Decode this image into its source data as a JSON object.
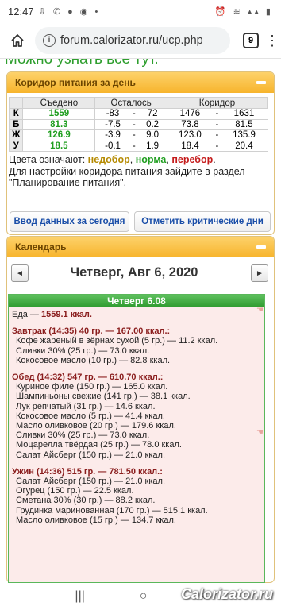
{
  "status": {
    "time": "12:47",
    "left_icons": "⇩ ✆ ● ◉ •",
    "right_icons": "⏰ ≋ ▴▴ ▮"
  },
  "browser": {
    "url": "forum.calorizator.ru/ucp.php",
    "tab_count": "9"
  },
  "page": {
    "cut_heading": "Можно узнать всё тут."
  },
  "corridor": {
    "title": "Коридор питания за день",
    "headers": [
      "",
      "Съедено",
      "Осталось",
      "Коридор"
    ],
    "rows": [
      {
        "label": "К",
        "eaten": "1559",
        "left_a": "-83",
        "left_b": "72",
        "corr_a": "1476",
        "corr_b": "1631"
      },
      {
        "label": "Б",
        "eaten": "81.3",
        "left_a": "-7.5",
        "left_b": "0.2",
        "corr_a": "73.8",
        "corr_b": "81.5"
      },
      {
        "label": "Ж",
        "eaten": "126.9",
        "left_a": "-3.9",
        "left_b": "9.0",
        "corr_a": "123.0",
        "corr_b": "135.9"
      },
      {
        "label": "У",
        "eaten": "18.5",
        "left_a": "-0.1",
        "left_b": "1.9",
        "corr_a": "18.4",
        "corr_b": "20.4"
      }
    ],
    "legend_prefix": "Цвета означают: ",
    "legend_under": "недобор",
    "legend_sep1": ", ",
    "legend_norm": "норма",
    "legend_sep2": ", ",
    "legend_over": "перебор",
    "legend_end": ".",
    "hint": "Для настройки коридора питания зайдите в раздел \"Планирование питания\".",
    "btn_input": "Ввод данных за сегодня",
    "btn_critical": "Отметить критические дни"
  },
  "calendar": {
    "title": "Календарь",
    "date_title": "Четверг, Авг 6, 2020",
    "prev": "◄",
    "next": "►",
    "day_header": "Четверг 6.08",
    "food_label": "Еда — ",
    "food_total": "1559.1 ккал.",
    "meals": [
      {
        "title": "Завтрак (14:35) 40 гр. — 167.00 ккал.:",
        "items": [
          "Кофе жареный в зёрнах сухой (5 гр.) — 11.2 ккал.",
          "Сливки 30% (25 гр.) — 73.0 ккал.",
          "Кокосовое масло (10 гр.) — 82.8 ккал."
        ]
      },
      {
        "title": "Обед (14:32) 547 гр. — 610.70 ккал.:",
        "items": [
          "Куриное филе (150 гр.) — 165.0 ккал.",
          "Шампиньоны свежие (141 гр.) — 38.1 ккал.",
          "Лук репчатый (31 гр.) — 14.6 ккал.",
          "Кокосовое масло (5 гр.) — 41.4 ккал.",
          "Масло оливковое (20 гр.) — 179.6 ккал.",
          "Сливки 30% (25 гр.) — 73.0 ккал.",
          "Моцарелла твёрдая (25 гр.) — 78.0 ккал.",
          "Салат Айсберг (150 гр.) — 21.0 ккал."
        ]
      },
      {
        "title": "Ужин (14:36) 515 гр. — 781.50 ккал.:",
        "items": [
          "Салат Айсберг (150 гр.) — 21.0 ккал.",
          "Огурец (150 гр.) — 22.5 ккал.",
          "Сметана 30% (30 гр.) — 88.2 ккал.",
          "Грудинка маринованная (170 гр.) — 515.1 ккал.",
          "Масло оливковое (15 гр.) — 134.7 ккал."
        ]
      }
    ]
  },
  "navbar": {
    "recent": "|||",
    "home": "○",
    "back": "‹"
  },
  "watermark": "Calorizator.ru"
}
